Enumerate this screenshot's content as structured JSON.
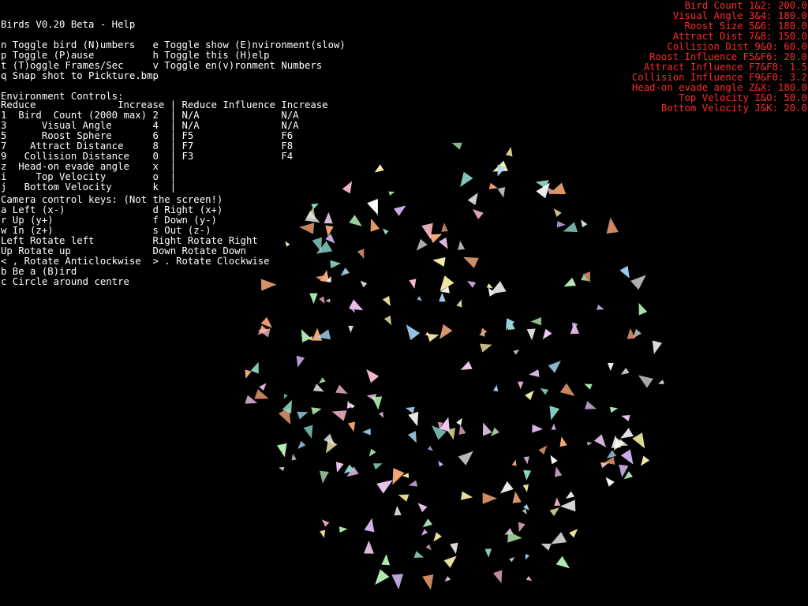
{
  "app": {
    "title": "Birds V0.20 Beta - Help",
    "text_color": "#ffffff",
    "stats_color": "#ff2a2a",
    "background": "#000000"
  },
  "help": {
    "toggle_lines": [
      "n Toggle bird (N)umbers   e Toggle show (E)nvironment(slow)",
      "p Toggle (P)ause          h Toggle this (H)elp",
      "t (T)oggle Frames/Sec     v Toggle en(v)ronment Numbers",
      "q Snap shot to Pickture.bmp"
    ],
    "env_heading": "Environment Controls:",
    "env_lines": [
      "Reduce              Increase | Reduce Influence Increase",
      "1  Bird  Count (2000 max) 2  | N/A              N/A",
      "3      Visual Angle       4  | N/A              N/A",
      "5      Roost Sphere       6  | F5               F6",
      "7    Attract Distance     8  | F7               F8",
      "9   Collision Distance    0  | F3               F4",
      "z  Head-on evade angle    x  |",
      "i     Top Velocity        o  |",
      "j   Bottom Velocity       k  |"
    ],
    "camera_heading": "Camera control keys: (Not the screen!)",
    "camera_lines": [
      "a Left (x-)               d Right (x+)",
      "r Up (y+)                 f Down (y-)",
      "w In (z+)                 s Out (z-)",
      "Left Rotate left          Right Rotate Right",
      "Up Rotate up              Down Rotate Down",
      "< , Rotate Anticlockwise  > . Rotate Clockwise",
      "b Be a (B)ird",
      "c Circle around centre"
    ]
  },
  "stats": [
    "Bird Count 1&2: 200.0",
    "Visual Angle 3&4: 180.0",
    "Roost Size 5&6: 180.0",
    "Attract Dist 7&8: 150.0",
    "Collision Dist 9&0: 60.0",
    "Roost Influence F5&F6: 20.0",
    "Attract Influence F7&F8: 1.5",
    "Collision Influence F9&F0: 3.2",
    "Head-on evade angle Z&X: 180.0",
    "Top Velocity I&O: 50.0",
    "Bottom Velocity J&K: 20.0"
  ],
  "flock": {
    "colors": [
      "#ffffff",
      "#f7b8c8",
      "#b4f0b4",
      "#a8d8f8",
      "#f8f0a8",
      "#d8b8f8",
      "#f8a878",
      "#e0e0e0",
      "#90e0d0",
      "#f0c8f0"
    ]
  }
}
